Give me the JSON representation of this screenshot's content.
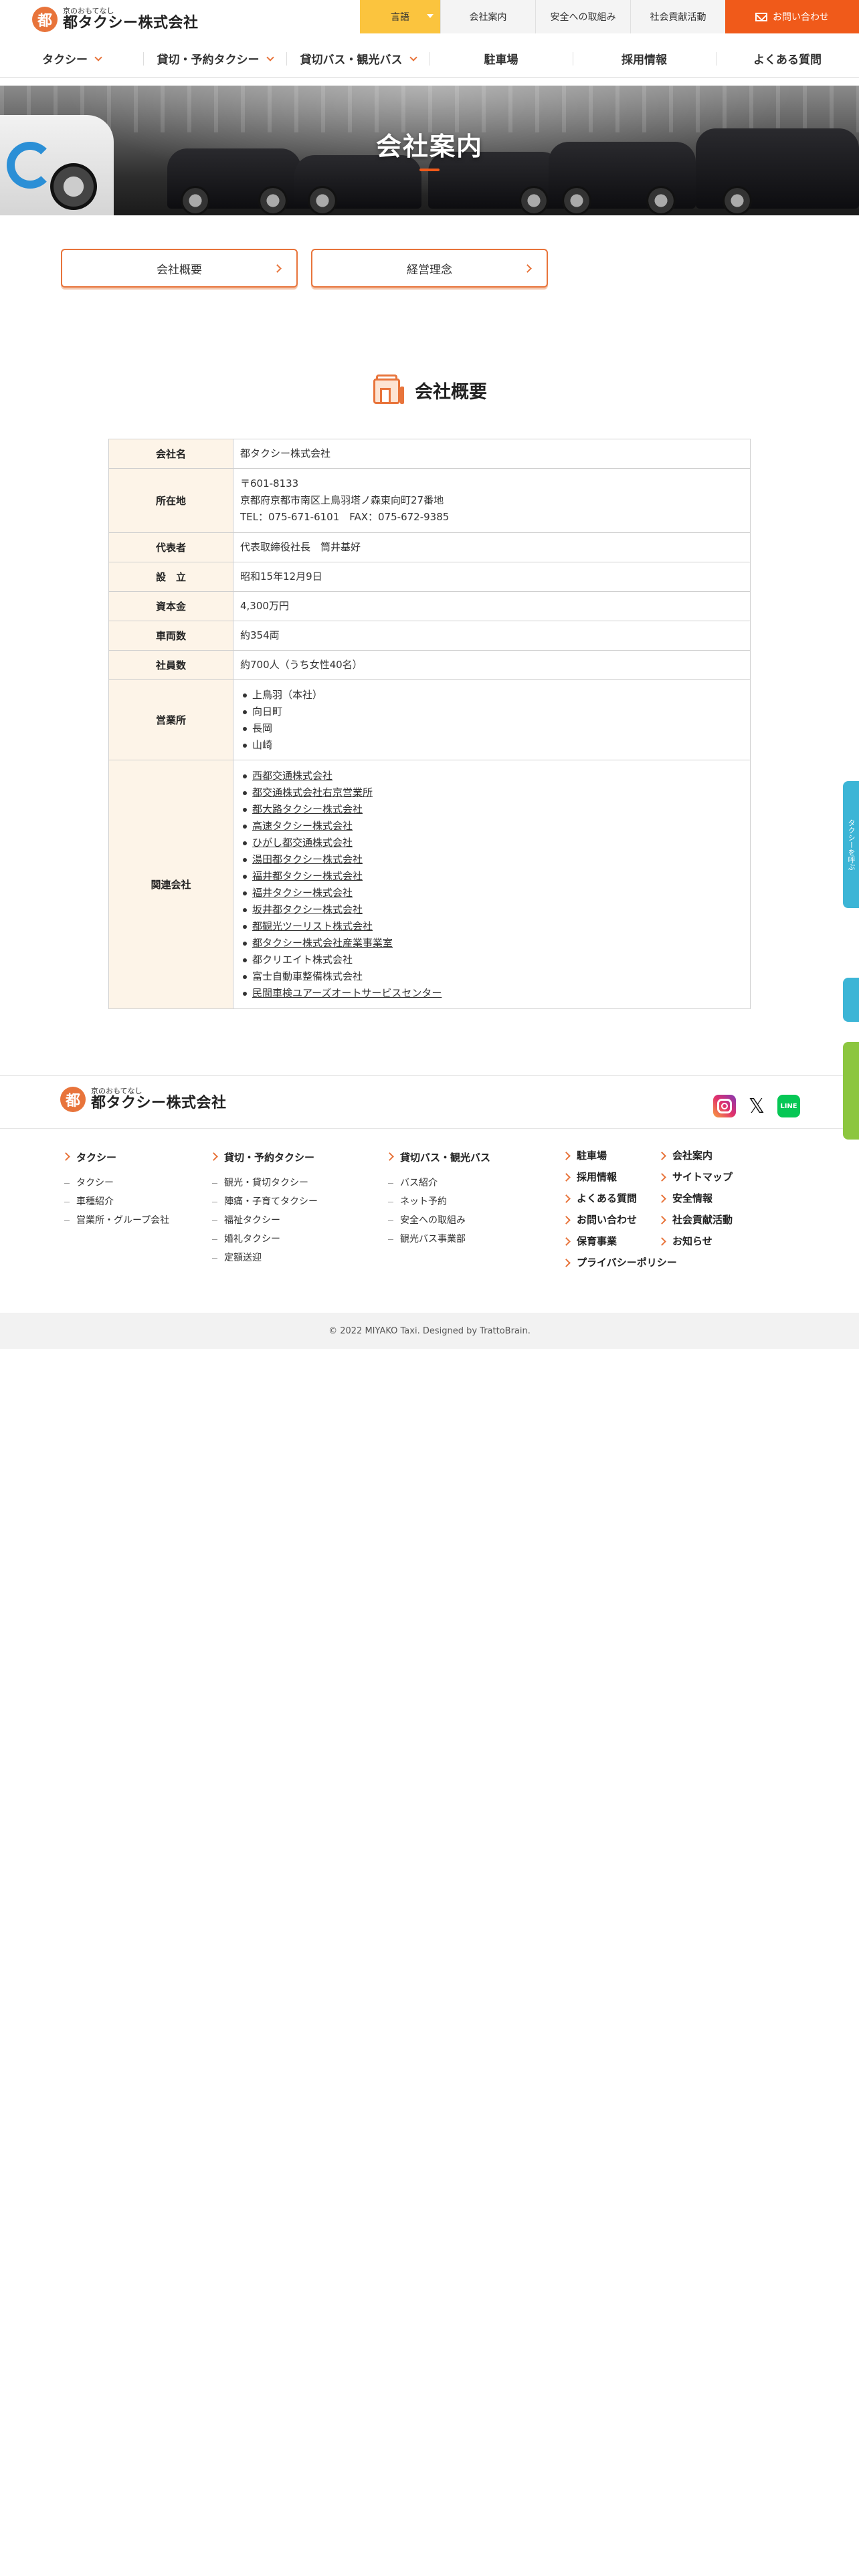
{
  "header": {
    "logo_tagline": "京のおもてなし",
    "logo_name": "都タクシー株式会社",
    "logo_mark": "都",
    "util": {
      "language": "言語",
      "company": "会社案内",
      "safety": "安全への取組み",
      "social": "社会貢献活動",
      "contact": "お問い合わせ"
    },
    "nav": [
      "タクシー",
      "貸切・予約タクシー",
      "貸切バス・観光バス",
      "駐車場",
      "採用情報",
      "よくある質問"
    ]
  },
  "hero": {
    "title": "会社案内"
  },
  "anchors": {
    "overview": "会社概要",
    "philosophy": "経営理念"
  },
  "section": {
    "title": "会社概要"
  },
  "table": {
    "company_name": {
      "label": "会社名",
      "value": "都タクシー株式会社"
    },
    "address": {
      "label": "所在地",
      "postal": "〒601-8133",
      "line": "京都府京都市南区上鳥羽塔ノ森東向町27番地",
      "tel": "TEL：075-671-6101　FAX：075-672-9385"
    },
    "representative": {
      "label": "代表者",
      "value": "代表取締役社長　筒井基好"
    },
    "established": {
      "label": "設　立",
      "value": "昭和15年12月9日"
    },
    "capital": {
      "label": "資本金",
      "value": "4,300万円"
    },
    "vehicles": {
      "label": "車両数",
      "value": "約354両"
    },
    "employees": {
      "label": "社員数",
      "value": "約700人（うち女性40名）"
    },
    "offices": {
      "label": "営業所",
      "items": [
        "上鳥羽（本社）",
        "向日町",
        "長岡",
        "山崎"
      ]
    },
    "affiliates": {
      "label": "関連会社",
      "items": [
        {
          "name": "西都交通株式会社",
          "link": true
        },
        {
          "name": "都交通株式会社右京営業所",
          "link": true
        },
        {
          "name": "都大路タクシー株式会社",
          "link": true
        },
        {
          "name": "高速タクシー株式会社",
          "link": true
        },
        {
          "name": "ひがし都交通株式会社",
          "link": true
        },
        {
          "name": "湯田都タクシー株式会社",
          "link": true
        },
        {
          "name": "福井都タクシー株式会社",
          "link": true
        },
        {
          "name": "福井タクシー株式会社",
          "link": true
        },
        {
          "name": "坂井都タクシー株式会社",
          "link": true
        },
        {
          "name": "都観光ツーリスト株式会社",
          "link": true
        },
        {
          "name": "都タクシー株式会社産業事業室",
          "link": true
        },
        {
          "name": "都クリエイト株式会社",
          "link": false
        },
        {
          "name": "富士自動車整備株式会社",
          "link": false
        },
        {
          "name": "民間車検ユアーズオートサービスセンター",
          "link": true
        }
      ]
    }
  },
  "footer": {
    "logo_tagline": "京のおもてなし",
    "logo_name": "都タクシー株式会社",
    "social": [
      "instagram-icon",
      "x-icon",
      "line-icon"
    ],
    "line_label": "LINE",
    "x_label": "𝕏",
    "col1": {
      "head": "タクシー",
      "items": [
        "タクシー",
        "車種紹介",
        "営業所・グループ会社"
      ]
    },
    "col2": {
      "head": "貸切・予約タクシー",
      "items": [
        "観光・貸切タクシー",
        "陣痛・子育てタクシー",
        "福祉タクシー",
        "婚礼タクシー",
        "定額送迎"
      ]
    },
    "col3": {
      "head": "貸切バス・観光バス",
      "items": [
        "バス紹介",
        "ネット予約",
        "安全への取組み",
        "観光バス事業部"
      ]
    },
    "col4": [
      "駐車場",
      "採用情報",
      "よくある質問",
      "お問い合わせ",
      "保育事業",
      "プライバシーポリシー"
    ],
    "col5": [
      "会社案内",
      "サイトマップ",
      "安全情報",
      "社会貢献活動",
      "お知らせ"
    ],
    "copyright": "© 2022 MIYAKO Taxi. Designed by TrattoBrain."
  },
  "side_tabs": {
    "tab1": "タクシーを呼ぶ"
  },
  "colors": {
    "accent": "#e8743b",
    "contact": "#f05a1a",
    "lang": "#fbc43e",
    "table_head": "#fdf4e8"
  }
}
